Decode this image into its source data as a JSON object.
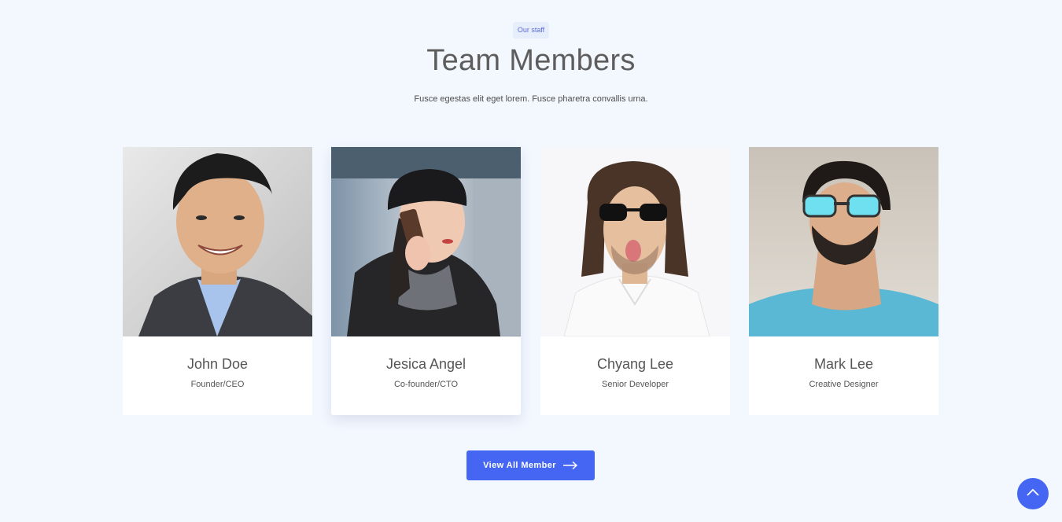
{
  "section": {
    "badge": "Our staff",
    "title": "Team Members",
    "subtitle": "Fusce egestas elit eget lorem. Fusce pharetra convallis urna."
  },
  "members": [
    {
      "name": "John Doe",
      "role": "Founder/CEO"
    },
    {
      "name": "Jesica Angel",
      "role": "Co-founder/CTO"
    },
    {
      "name": "Chyang Lee",
      "role": "Senior Developer"
    },
    {
      "name": "Mark Lee",
      "role": "Creative Designer"
    }
  ],
  "cta": {
    "label": "View All Member",
    "icon": "arrow-right-icon"
  },
  "scroll_top": {
    "icon": "chevron-up-icon"
  },
  "colors": {
    "accent": "#4466f2",
    "background": "#f3f7fe",
    "badge_bg": "#e6edfb"
  }
}
